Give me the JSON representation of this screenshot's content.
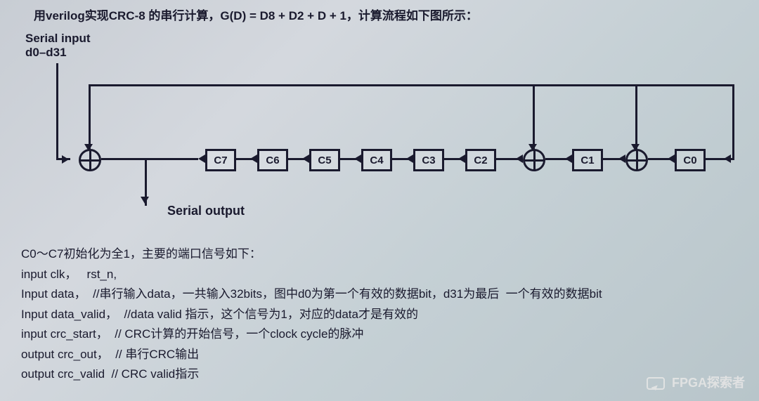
{
  "question": "用verilog实现CRC-8 的串行计算，G(D) = D8 + D2 + D + 1，计算流程如下图所示：",
  "labels": {
    "serial_input_l1": "Serial input",
    "serial_input_l2": "d0–d31",
    "serial_output": "Serial output"
  },
  "registers": [
    "C7",
    "C6",
    "C5",
    "C4",
    "C3",
    "C2",
    "C1",
    "C0"
  ],
  "ports_header": "C0～C7初始化为全1，主要的端口信号如下：",
  "ports": [
    {
      "sig": "input clk，   rst_n,",
      "comment": ""
    },
    {
      "sig": "Input data，  ",
      "comment": "//串行输入data，一共输入32bits，图中d0为第一个有效的数据bit，d31为最后  一个有效的数据bit"
    },
    {
      "sig": "Input data_valid，  ",
      "comment": "//data valid 指示，这个信号为1，对应的data才是有效的"
    },
    {
      "sig": "input crc_start，  ",
      "comment": "// CRC计算的开始信号，一个clock cycle的脉冲"
    },
    {
      "sig": "output crc_out，  ",
      "comment": "// 串行CRC输出"
    },
    {
      "sig": "output crc_valid  ",
      "comment": "// CRC valid指示"
    }
  ],
  "watermark": "FPGA探索者",
  "chart_data": {
    "type": "block-diagram",
    "title": "CRC-8 LFSR serial computation",
    "polynomial": "G(D) = D^8 + D^2 + D + 1",
    "registers": [
      "C0",
      "C1",
      "C2",
      "C3",
      "C4",
      "C5",
      "C6",
      "C7"
    ],
    "initial_value": "all ones (0xFF)",
    "xor_taps_before": [
      "C0",
      "C1",
      "C7(input)"
    ],
    "shift_direction": "C0 -> C1 -> ... -> C7 -> serial_output / feedback",
    "feedback_source": "C7 output XOR serial_input",
    "serial_input": "d0–d31 (32 bits, d0 first)",
    "serial_output_node": "after C7 (before first XOR inputs)"
  }
}
